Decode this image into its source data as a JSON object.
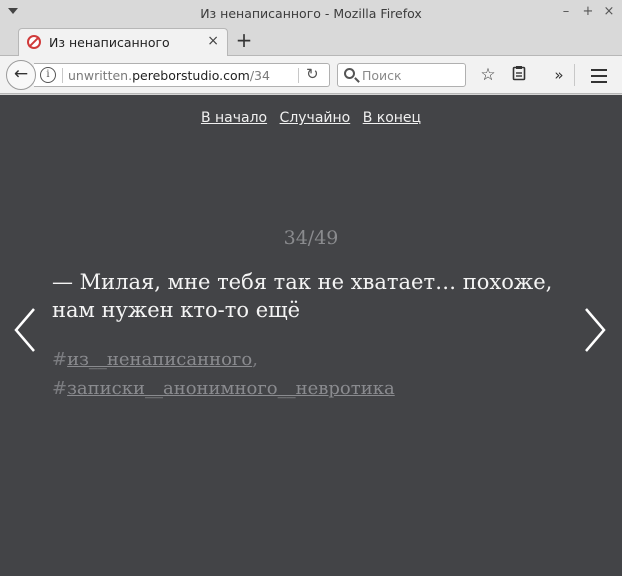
{
  "window": {
    "title": "Из ненаписанного - Mozilla Firefox",
    "minimize_glyph": "–",
    "maximize_glyph": "+",
    "close_glyph": "×"
  },
  "tab": {
    "label": "Из ненаписанного",
    "close_glyph": "×",
    "new_tab_glyph": "+"
  },
  "navbar": {
    "back_glyph": "←",
    "url_prefix": "unwritten.",
    "url_domain": "pereborstudio.com",
    "url_path": "/34",
    "reload_glyph": "↻",
    "search_placeholder": "Поиск",
    "star_glyph": "☆",
    "clipboard_glyph": "📋",
    "overflow_glyph": "»"
  },
  "page": {
    "nav": {
      "first": "В начало",
      "random": "Случайно",
      "last": "В конец"
    },
    "counter": "34/49",
    "quote": "— Милая, мне тебя так не хватает… похоже, нам нужен кто-то ещё",
    "tags": [
      {
        "hash": "#",
        "text": "из__ненаписанного",
        "after": ","
      },
      {
        "hash": "#",
        "text": "записки__анонимного__невротика",
        "after": ""
      }
    ],
    "arrow_color": "#ffffff"
  }
}
